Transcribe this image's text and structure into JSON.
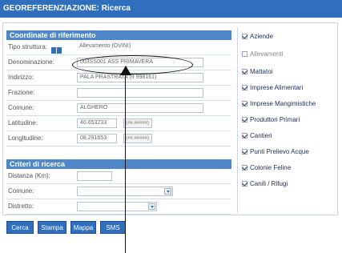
{
  "app": {
    "title": "GEOREFERENZIAZIONE: Ricerca"
  },
  "sections": {
    "coords": "Coordinate di riferimento",
    "criteria": "Criteri di ricerca"
  },
  "fields": {
    "tipo_struttura": {
      "label": "Tipo struttura:",
      "value": "Allevamento (OVINI)"
    },
    "denominazione": {
      "label": "Denominazione:",
      "value": "003SS001 ASS PRIMAVERA"
    },
    "indirizzo": {
      "label": "Indirizzo:",
      "value": "PALA PRASTRATA (9 998161)"
    },
    "frazione": {
      "label": "Frazione:",
      "value": ""
    },
    "comune": {
      "label": "Comune:",
      "value": "ALGHERO"
    },
    "latitudine": {
      "label": "Latitudine:",
      "value": "40.653233",
      "suffix": "(##.#####)"
    },
    "longitudine": {
      "label": "Longitudine:",
      "value": "08.291653",
      "suffix": "(##.#####)"
    }
  },
  "criteria": {
    "distanza": {
      "label": "Distanza (Km):",
      "value": ""
    },
    "comune": {
      "label": "Comune:",
      "value": ""
    },
    "distretto": {
      "label": "Distretto:",
      "value": ""
    }
  },
  "filters": [
    {
      "label": "Aziende",
      "checked": true
    },
    {
      "label": "Allevamenti",
      "checked": false
    },
    {
      "label": "Mattatoi",
      "checked": true
    },
    {
      "label": "Imprese Alimentari",
      "checked": true
    },
    {
      "label": "Imprese Mangimistiche",
      "checked": true
    },
    {
      "label": "Produttori Primari",
      "checked": true
    },
    {
      "label": "Cantieri",
      "checked": true
    },
    {
      "label": "Punti Prelievo Acque",
      "checked": true
    },
    {
      "label": "Colonie Feline",
      "checked": true
    },
    {
      "label": "Canili / Rifugi",
      "checked": true
    }
  ],
  "buttons": {
    "cerca": "Cerca",
    "stampa": "Stampa",
    "mappa": "Mappa",
    "sms": "SMS"
  },
  "colors": {
    "titlebar": "#2f6fbe",
    "section": "#4f86c8",
    "button": "#2f6fbe"
  }
}
